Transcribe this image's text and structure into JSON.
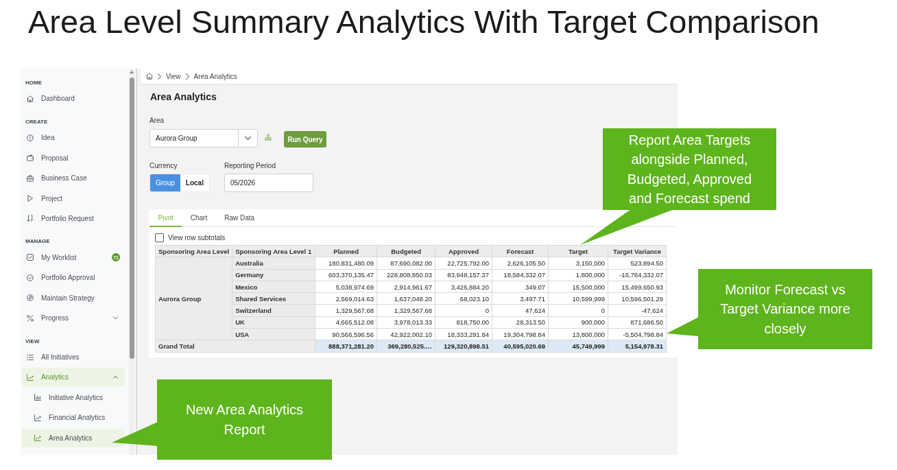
{
  "slide_title": "Area Level Summary Analytics With Target Comparison",
  "sidebar": {
    "sections": [
      {
        "heading": "HOME",
        "items": [
          {
            "label": "Dashboard",
            "selected": false
          }
        ]
      },
      {
        "heading": "CREATE",
        "items": [
          {
            "label": "Idea",
            "selected": false
          },
          {
            "label": "Proposal",
            "selected": false
          },
          {
            "label": "Business Case",
            "selected": false
          },
          {
            "label": "Project",
            "selected": false
          },
          {
            "label": "Portfolio Request",
            "selected": false
          }
        ]
      },
      {
        "heading": "MANAGE",
        "items": [
          {
            "label": "My Worklist",
            "selected": false,
            "badge": "71"
          },
          {
            "label": "Portfolio Approval",
            "selected": false
          },
          {
            "label": "Maintain Strategy",
            "selected": false
          },
          {
            "label": "Progress",
            "selected": false,
            "expanded": false
          }
        ]
      },
      {
        "heading": "VIEW",
        "items": [
          {
            "label": "All Initiatives",
            "selected": false
          },
          {
            "label": "Analytics",
            "selected": true,
            "expanded": true,
            "children": [
              {
                "label": "Initiative Analytics",
                "selected": false
              },
              {
                "label": "Financial Analytics",
                "selected": false
              },
              {
                "label": "Area Analytics",
                "selected": true
              }
            ]
          }
        ]
      }
    ]
  },
  "breadcrumb": [
    "View",
    "Area Analytics"
  ],
  "page_title": "Area Analytics",
  "filters": {
    "area": {
      "label": "Area",
      "value": "Aurora Group"
    },
    "run_button": "Run Query",
    "currency": {
      "label": "Currency",
      "options": [
        {
          "label": "Group",
          "selected": true
        },
        {
          "label": "Local",
          "selected": false
        }
      ]
    },
    "reporting_period": {
      "label": "Reporting Period",
      "value": "05/2026"
    }
  },
  "pivot": {
    "tabs": [
      {
        "label": "Pivot",
        "selected": true
      },
      {
        "label": "Chart",
        "selected": false
      },
      {
        "label": "Raw Data",
        "selected": false
      }
    ],
    "subtotals": {
      "label": "View row subtotals",
      "checked": false
    },
    "table": {
      "columns": [
        "Sponsoring Area Level",
        "Sponsoring Area Level 1",
        "Planned",
        "Budgeted",
        "Approved",
        "Forecast",
        "Target",
        "Target Variance"
      ],
      "row_group": "Aurora Group",
      "rows": [
        {
          "label": "Australia",
          "values": [
            "180,831,480.09",
            "87,690,082.00",
            "22,725,792.00",
            "2,626,105.50",
            "3,150,000",
            "523,894.50"
          ]
        },
        {
          "label": "Germany",
          "values": [
            "603,370,135.47",
            "228,808,850.03",
            "83,948,157.37",
            "18,584,332.07",
            "1,800,000",
            "-16,784,332.07"
          ]
        },
        {
          "label": "Mexico",
          "values": [
            "5,038,974.69",
            "2,914,961.67",
            "3,426,884.20",
            "349.07",
            "15,500,000",
            "15,499,650.93"
          ]
        },
        {
          "label": "Shared Services",
          "values": [
            "2,569,014.63",
            "1,637,048.20",
            "68,023.10",
            "3,497.71",
            "10,599,999",
            "10,596,501.29"
          ]
        },
        {
          "label": "Switzerland",
          "values": [
            "1,329,567.68",
            "1,329,567.68",
            "0",
            "47,624",
            "0",
            "-47,624"
          ]
        },
        {
          "label": "UK",
          "values": [
            "4,665,512.08",
            "3,978,013.33",
            "818,750.00",
            "28,313.50",
            "900,000",
            "871,686.50"
          ]
        },
        {
          "label": "USA",
          "values": [
            "90,566,596.56",
            "42,922,002.10",
            "18,333,291.84",
            "19,304,798.84",
            "13,800,000",
            "-5,504,798.84"
          ]
        }
      ],
      "total": {
        "label": "Grand Total",
        "values": [
          "888,371,281.20",
          "369,280,525.…",
          "129,320,898.51",
          "40,595,020.69",
          "45,749,999",
          "5,154,978.31"
        ]
      }
    }
  },
  "callouts": [
    {
      "text": "Report Area Targets alongside Planned, Budgeted, Approved and Forecast spend"
    },
    {
      "text": "Monitor Forecast vs Target Variance more closely"
    },
    {
      "text": "New Area Analytics Report"
    }
  ]
}
